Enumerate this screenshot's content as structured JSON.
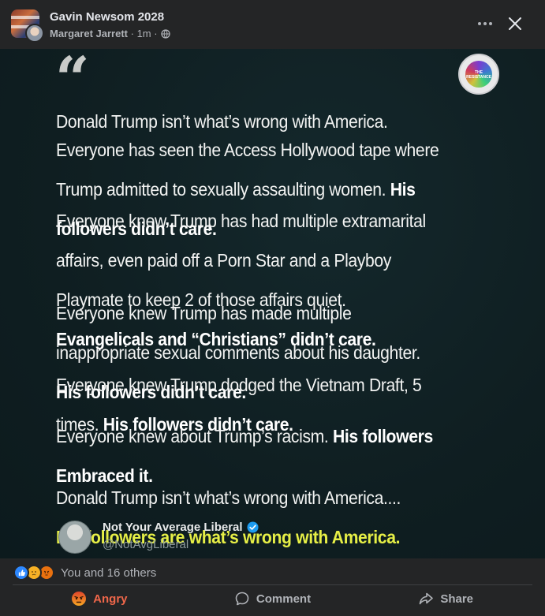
{
  "header": {
    "group_name": "Gavin Newsom 2028",
    "author": "Margaret Jarrett",
    "time": "1m",
    "more_icon": "more-horizontal-icon",
    "close_icon": "close-icon",
    "privacy_icon": "globe-icon"
  },
  "post_image": {
    "quote_icon": "quote-mark-icon",
    "badge_text": "THE RESISTANCE",
    "p1": "Donald Trump isn’t what’s wrong with America.",
    "p2_a": "Everyone has seen the Access Hollywood tape where",
    "p2_b": "Trump admitted to sexually assaulting women.",
    "p2_c": "His",
    "p2_d": "followers didn’t care.",
    "p3_a": "Everyone knew Trump has had multiple extramarital",
    "p3_b": "affairs, even paid off a Porn Star and a Playboy",
    "p3_c": "Playmate to keep 2 of those affairs quiet.",
    "p3_d": "Evangelicals and “Christians” didn’t care.",
    "p4_a": "Everyone knew Trump has made multiple",
    "p4_b": "inappropriate sexual comments about his daughter.",
    "p4_c": "His followers didn’t care.",
    "p5_a": "Everyone knew Trump dodged the Vietnam Draft, 5",
    "p5_b": "times.",
    "p5_c": "His followers didn’t care.",
    "p6_a": "Everyone knew about Trump’s racism.",
    "p6_b": "His followers",
    "p6_c": "Embraced it.",
    "p7_a": "Donald Trump isn’t what’s wrong with America....",
    "p7_b": "His followers are what’s wrong with America.",
    "source_name": "Not Your Average Liberal",
    "source_handle": "@NotAvgLiberal",
    "verified_icon": "verified-badge-icon",
    "colors": {
      "background": "#0f1e21",
      "highlight": "#e6ef46",
      "text": "#f2f3f2"
    }
  },
  "reactions": {
    "icons": [
      "like-icon",
      "sad-icon",
      "angry-icon"
    ],
    "summary": "You and 16 others"
  },
  "actions": {
    "react_label": "Angry",
    "comment_label": "Comment",
    "share_label": "Share",
    "react_color": "#f0674a"
  }
}
